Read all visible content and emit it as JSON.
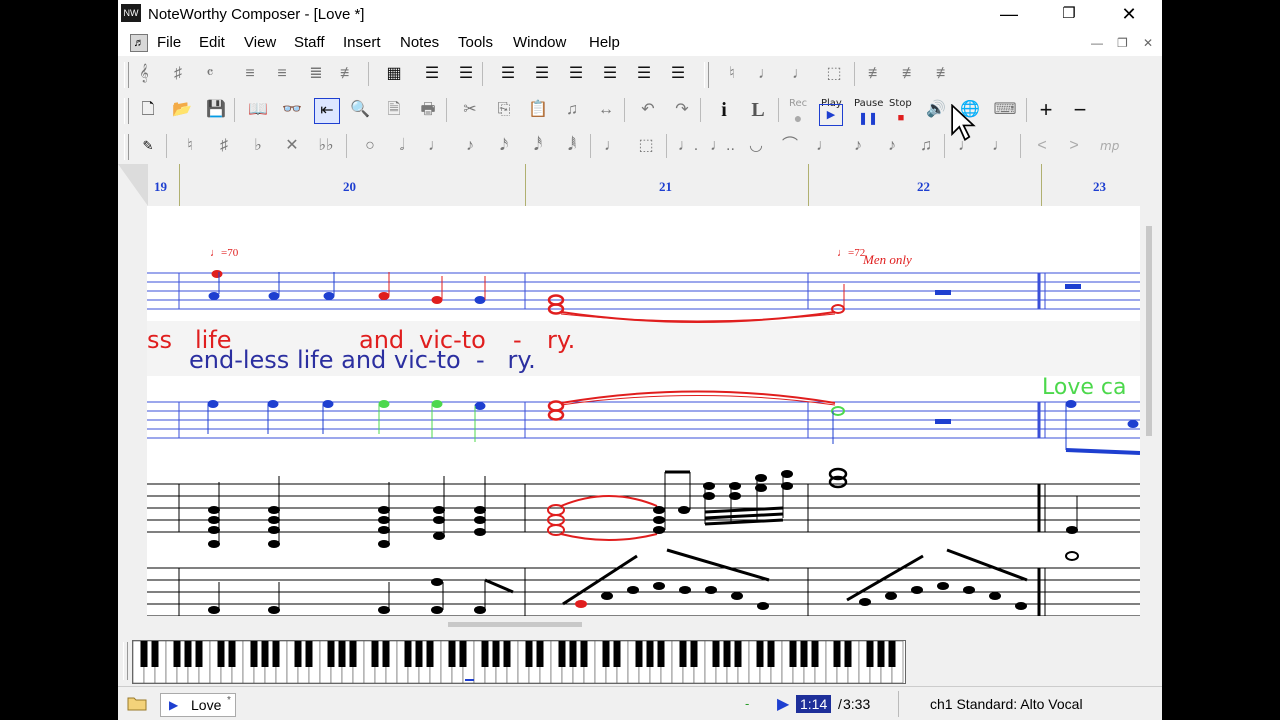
{
  "window": {
    "app_icon_text": "NW",
    "title": "NoteWorthy Composer - [Love *]",
    "minimize": "—",
    "maximize": "❐",
    "close": "✕"
  },
  "menu": {
    "items": [
      "File",
      "Edit",
      "View",
      "Staff",
      "Insert",
      "Notes",
      "Tools",
      "Window",
      "Help"
    ],
    "mdi_min": "—",
    "mdi_restore": "❐",
    "mdi_close": "✕"
  },
  "toolbar": {
    "rec_label": "Rec",
    "play_label": "Play",
    "pause_label": "Pause",
    "stop_label": "Stop",
    "dynamic_label": "mp"
  },
  "measures": [
    "19",
    "20",
    "21",
    "22",
    "23"
  ],
  "score": {
    "tempo_1": "♩=70",
    "tempo_2": "♩=72",
    "expression": "Men only",
    "lyric_red_1": "ss",
    "lyric_red_2": "life",
    "lyric_red_3": "and",
    "lyric_red_4": "vic-to",
    "lyric_red_5": "-",
    "lyric_red_6": "ry.",
    "lyric_blue": "end-less life and vic-to  -   ry.",
    "lyric_green": "Love ca"
  },
  "statusbar": {
    "doc_tab": "Love",
    "doc_tab_mark": "*",
    "dash": "-",
    "time_current": "1:14",
    "time_sep": "/",
    "time_total": "3:33",
    "staff_info": "ch1 Standard: Alto Vocal"
  },
  "colors": {
    "selection_blue": "#1e3fd0",
    "highlight_red": "#e01e1e",
    "lyric_green": "#4cd84c",
    "time_bg": "#1e2f9a"
  }
}
